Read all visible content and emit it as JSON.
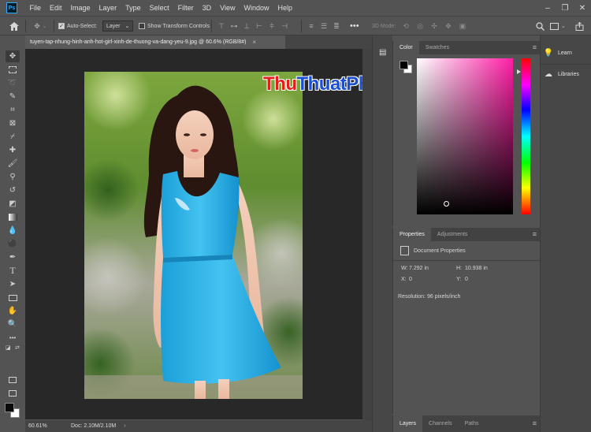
{
  "app": {
    "logo_text": "Ps",
    "menu": [
      "File",
      "Edit",
      "Image",
      "Layer",
      "Type",
      "Select",
      "Filter",
      "3D",
      "View",
      "Window",
      "Help"
    ]
  },
  "options_bar": {
    "auto_select_label": "Auto-Select:",
    "auto_select_checked": true,
    "auto_select_target": "Layer",
    "show_transform_label": "Show Transform Controls",
    "show_transform_checked": false,
    "mode_3d_label": "3D Mode:"
  },
  "document": {
    "tab_title": "tuyen-tap-nhung-hinh-anh-hot-girl-xinh-de-thuong-va-dang-yeu-9.jpg @ 60.6% (RGB/8#)",
    "zoom": "60.61%",
    "doc_size": "Doc: 2.10M/2.10M",
    "foreground_color": "#000000",
    "background_color": "#ffffff"
  },
  "watermark": {
    "part1": "Thu",
    "part2": "ThuatPhanMem.vn"
  },
  "color_panel": {
    "tabs": [
      "Color",
      "Swatches"
    ],
    "active_tab": "Color",
    "hue_color": "#ff1ea5"
  },
  "properties_panel": {
    "tabs": [
      "Properties",
      "Adjustments"
    ],
    "active_tab": "Properties",
    "section_title": "Document Properties",
    "width_label": "W:",
    "width_value": "7.292 in",
    "height_label": "H:",
    "height_value": "10.938 in",
    "x_label": "X:",
    "x_value": "0",
    "y_label": "Y:",
    "y_value": "0",
    "resolution": "Resolution: 96 pixels/inch"
  },
  "layers_panel": {
    "tabs": [
      "Layers",
      "Channels",
      "Paths"
    ],
    "active_tab": "Layers"
  },
  "right_dock": {
    "learn_label": "Learn",
    "libraries_label": "Libraries"
  }
}
